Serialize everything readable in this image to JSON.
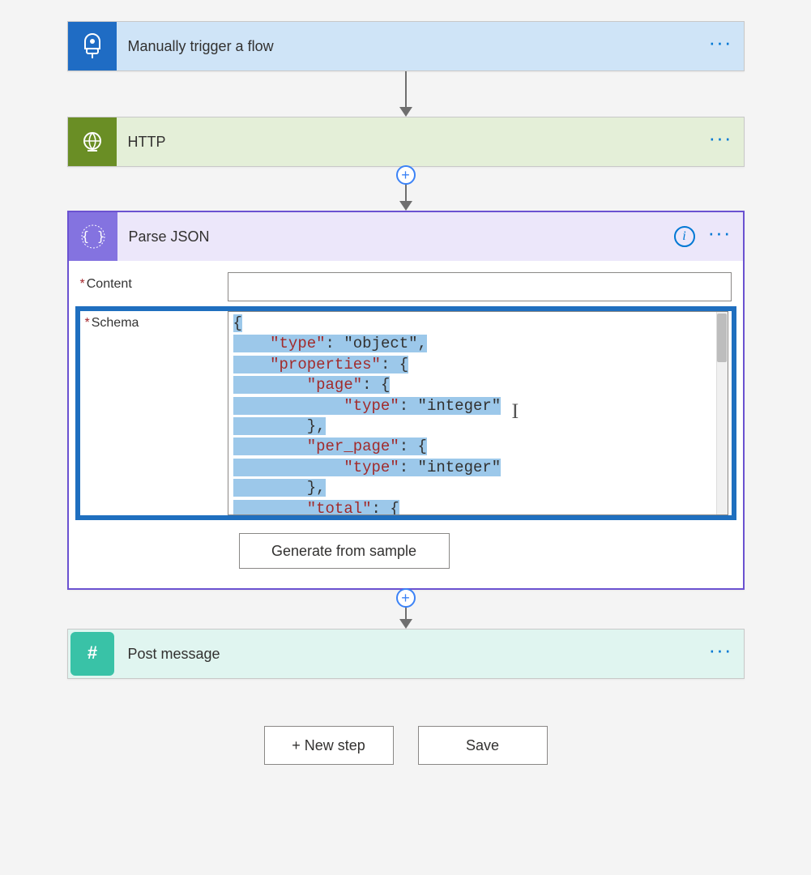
{
  "steps": {
    "trigger": {
      "title": "Manually trigger a flow"
    },
    "http": {
      "title": "HTTP"
    },
    "parse": {
      "title": "Parse JSON",
      "labels": {
        "content": "Content",
        "schema": "Schema"
      },
      "generate_btn": "Generate from sample",
      "schema_lines": [
        "{",
        "    \"type\": \"object\",",
        "    \"properties\": {",
        "        \"page\": {",
        "            \"type\": \"integer\"",
        "        },",
        "        \"per_page\": {",
        "            \"type\": \"integer\"",
        "        },",
        "        \"total\": {"
      ]
    },
    "post": {
      "title": "Post message"
    }
  },
  "footer": {
    "new_step": "+ New step",
    "save": "Save"
  },
  "required_marker": "*"
}
